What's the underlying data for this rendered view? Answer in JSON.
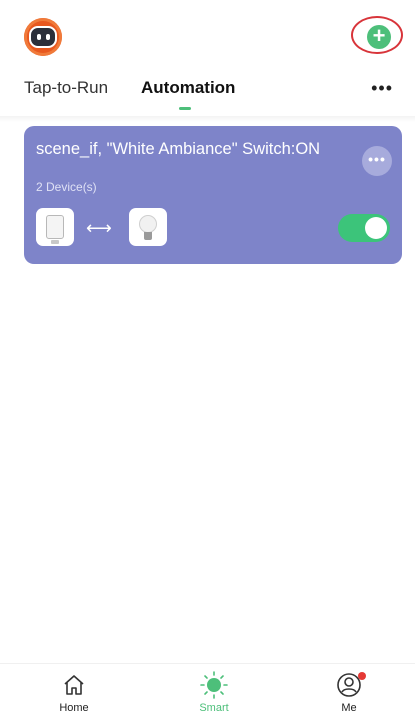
{
  "header": {
    "avatar_icon": "robot-avatar-icon",
    "add_icon": "plus-icon",
    "add_symbol": "+",
    "accent_color": "#4dbf7a",
    "highlight_ring_color": "#d8343a"
  },
  "tabs": {
    "items": [
      {
        "label": "Tap-to-Run",
        "active": false
      },
      {
        "label": "Automation",
        "active": true
      }
    ],
    "more_label": "•••"
  },
  "automation_card": {
    "title": "scene_if, \"White Ambiance\" Switch:ON",
    "device_count": "2 Device(s)",
    "menu_label": "•••",
    "card_color": "#7e84c9",
    "devices": [
      {
        "icon": "sensor-icon"
      },
      {
        "icon": "light-bulb-icon"
      }
    ],
    "arrow_symbol": "⟷",
    "toggle_on": true,
    "toggle_color": "#3cc47a"
  },
  "bottom_nav": {
    "items": [
      {
        "label": "Home",
        "icon": "home-icon",
        "active": false
      },
      {
        "label": "Smart",
        "icon": "smart-sun-icon",
        "active": true
      },
      {
        "label": "Me",
        "icon": "profile-icon",
        "active": false,
        "badge": true
      }
    ]
  }
}
